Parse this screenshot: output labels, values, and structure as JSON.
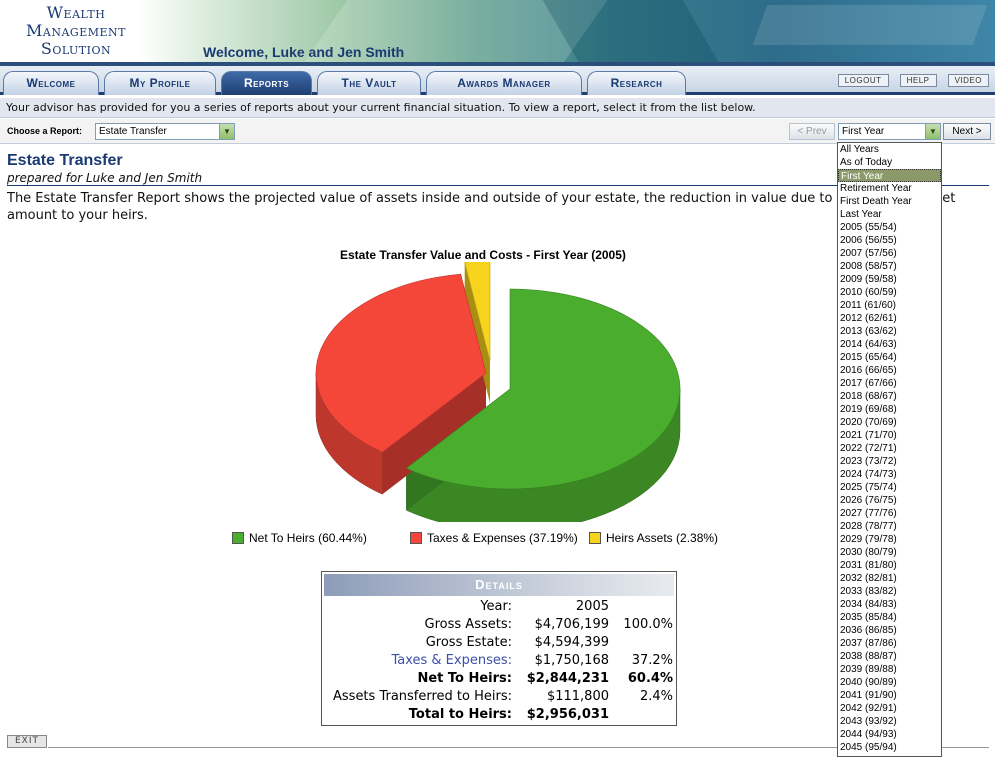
{
  "header": {
    "logo_line1": "Wealth",
    "logo_line2": "Management",
    "logo_line3": "Solution",
    "welcome": "Welcome, Luke and Jen Smith"
  },
  "tabs": [
    {
      "label": "Welcome",
      "active": false
    },
    {
      "label": "My Profile",
      "active": false
    },
    {
      "label": "Reports",
      "active": true
    },
    {
      "label": "The Vault",
      "active": false
    },
    {
      "label": "Awards Manager",
      "active": false
    },
    {
      "label": "Research",
      "active": false
    }
  ],
  "top_links": {
    "logout": "LOGOUT",
    "help": "HELP",
    "video": "VIDEO"
  },
  "info_text": "Your advisor has provided for you a series of reports about your current financial situation. To view a report, select it from the list below.",
  "report_bar": {
    "label": "Choose a Report:",
    "report_value": "Estate Transfer",
    "prev_label": "< Prev",
    "year_value": "First Year",
    "next_label": "Next >"
  },
  "report": {
    "title": "Estate Transfer",
    "subtitle": "prepared for Luke and Jen Smith",
    "description": "The Estate Transfer Report shows the projected value of assets inside and outside of your estate, the reduction in value due to taxes, and the net amount to your heirs."
  },
  "chart_data": {
    "type": "pie",
    "title": "Estate Transfer Value and Costs - First Year (2005)",
    "slices": [
      {
        "label": "Net To Heirs",
        "value": 60.44,
        "color": "#4aad2d"
      },
      {
        "label": "Taxes & Expenses",
        "value": 37.19,
        "color": "#f4473a"
      },
      {
        "label": "Heirs Assets",
        "value": 2.38,
        "color": "#f7d31c"
      }
    ],
    "legend": [
      {
        "text": "Net To Heirs (60.44%)",
        "color": "#4aad2d"
      },
      {
        "text": "Taxes & Expenses (37.19%)",
        "color": "#f4473a"
      },
      {
        "text": "Heirs Assets (2.38%)",
        "color": "#f7d31c"
      }
    ],
    "legend_position": "bottom"
  },
  "details": {
    "heading": "Details",
    "rows": [
      {
        "label": "Year:",
        "value": "2005",
        "pct": ""
      },
      {
        "label": "Gross Assets:",
        "value": "$4,706,199",
        "pct": "100.0%"
      },
      {
        "label": "Gross Estate:",
        "value": "$4,594,399",
        "pct": ""
      },
      {
        "label": "Taxes & Expenses:",
        "value": "$1,750,168",
        "pct": "37.2%"
      },
      {
        "label": "Net To Heirs:",
        "value": "$2,844,231",
        "pct": "60.4%"
      },
      {
        "label": "Assets Transferred to Heirs:",
        "value": "$111,800",
        "pct": "2.4%"
      },
      {
        "label": "Total to Heirs:",
        "value": "$2,956,031",
        "pct": ""
      }
    ]
  },
  "exit_label": "EXIT",
  "year_options": [
    "All Years",
    "As of Today",
    "First Year",
    "Retirement Year",
    "First Death Year",
    "Last Year",
    "2005 (55/54)",
    "2006 (56/55)",
    "2007 (57/56)",
    "2008 (58/57)",
    "2009 (59/58)",
    "2010 (60/59)",
    "2011 (61/60)",
    "2012 (62/61)",
    "2013 (63/62)",
    "2014 (64/63)",
    "2015 (65/64)",
    "2016 (66/65)",
    "2017 (67/66)",
    "2018 (68/67)",
    "2019 (69/68)",
    "2020 (70/69)",
    "2021 (71/70)",
    "2022 (72/71)",
    "2023 (73/72)",
    "2024 (74/73)",
    "2025 (75/74)",
    "2026 (76/75)",
    "2027 (77/76)",
    "2028 (78/77)",
    "2029 (79/78)",
    "2030 (80/79)",
    "2031 (81/80)",
    "2032 (82/81)",
    "2033 (83/82)",
    "2034 (84/83)",
    "2035 (85/84)",
    "2036 (86/85)",
    "2037 (87/86)",
    "2038 (88/87)",
    "2039 (89/88)",
    "2040 (90/89)",
    "2041 (91/90)",
    "2042 (92/91)",
    "2043 (93/92)",
    "2044 (94/93)",
    "2045 (95/94)"
  ],
  "selected_year_option": "First Year"
}
